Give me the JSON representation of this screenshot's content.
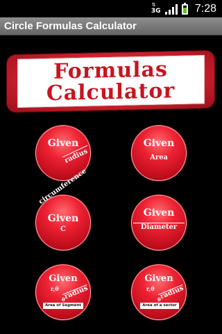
{
  "status": {
    "network": "3G",
    "time": "7:28"
  },
  "title": "Circle Formulas Calculator",
  "banner": {
    "line1": "Formulas",
    "line2": "Calculator"
  },
  "buttons": {
    "radius": {
      "given": "Given",
      "label": "radius"
    },
    "area": {
      "given": "Given",
      "label": "Area"
    },
    "circumference": {
      "given": "Given",
      "arc": "circumference",
      "label": "C"
    },
    "diameter": {
      "given": "Given",
      "label": "Diameter"
    },
    "segment": {
      "given": "Given",
      "vars": "r,θ",
      "radius": "radius",
      "theta": "θ",
      "label": "Area of Segment"
    },
    "sector": {
      "given": "Given",
      "vars": "r,θ",
      "radius": "radius",
      "theta": "θ",
      "label": "Area of a sector"
    }
  }
}
